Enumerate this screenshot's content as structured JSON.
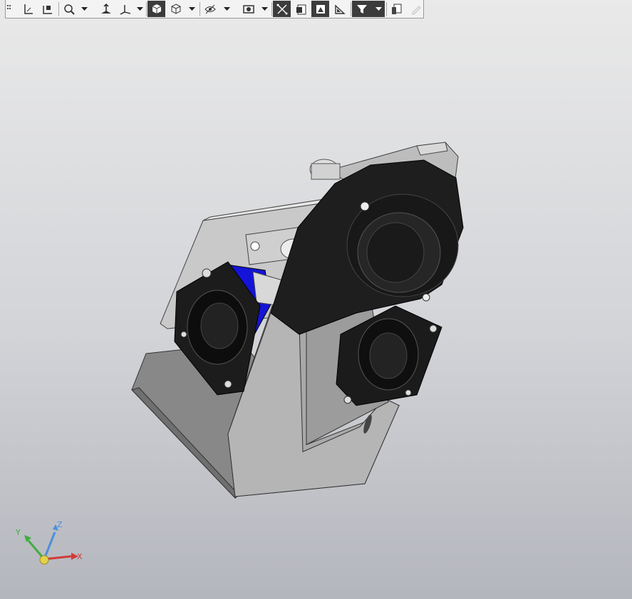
{
  "toolbar": {
    "buttons": [
      {
        "icon": "grip-handle-icon"
      },
      {
        "icon": "sketch-plane-icon"
      },
      {
        "icon": "section-view-icon"
      },
      {
        "icon": "zoom-window-icon"
      },
      {
        "icon": "dropdown-arrow-icon"
      },
      {
        "icon": "normal-to-icon"
      },
      {
        "icon": "orientation-axes-icon"
      },
      {
        "icon": "dropdown-arrow-icon"
      },
      {
        "icon": "shaded-cube-icon",
        "active": true
      },
      {
        "icon": "wireframe-cube-icon"
      },
      {
        "icon": "dropdown-arrow-icon"
      },
      {
        "icon": "hide-eye-icon"
      },
      {
        "icon": "dropdown-arrow-icon"
      },
      {
        "icon": "display-mode-icon"
      },
      {
        "icon": "dropdown-arrow-icon"
      },
      {
        "icon": "perspective-icon",
        "active": true
      },
      {
        "icon": "layers-icon"
      },
      {
        "icon": "show-objects-icon"
      },
      {
        "icon": "render-settings-icon"
      },
      {
        "icon": "filter-icon",
        "active": true
      },
      {
        "icon": "dropdown-arrow-icon",
        "active": true
      },
      {
        "icon": "properties-icon"
      },
      {
        "icon": "pencil-disabled-icon"
      }
    ]
  },
  "triad": {
    "x": "X",
    "y": "Y",
    "z": "Z"
  },
  "colors": {
    "x_axis": "#d23a3a",
    "y_axis": "#3fae3f",
    "z_axis": "#4a8fdc",
    "active_button": "#3c3c3c",
    "model_grey": "#a9a9a9",
    "fan_black": "#1c1c1c",
    "accent_blue": "#1414d8"
  }
}
